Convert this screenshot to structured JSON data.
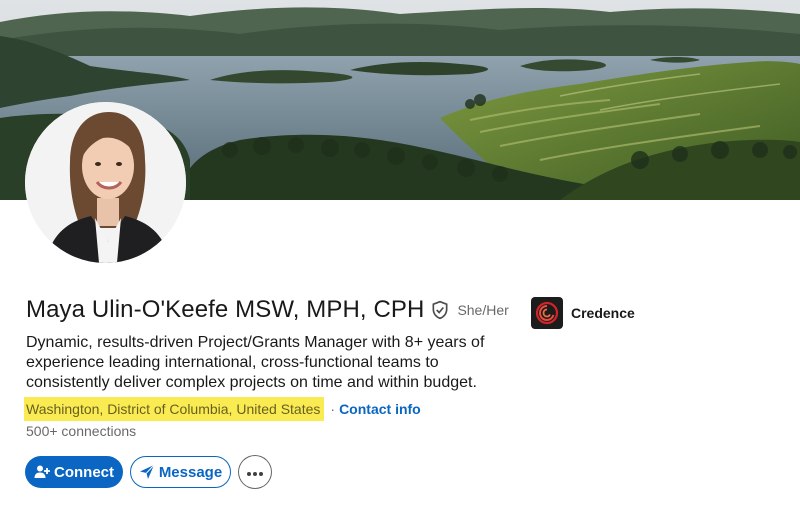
{
  "profile": {
    "name": "Maya Ulin-O'Keefe MSW, MPH, CPH",
    "pronouns": "She/Her",
    "headline": "Dynamic, results-driven Project/Grants Manager with 8+ years of experience leading international, cross-functional teams to consistently deliver complex projects on time and within budget.",
    "location": "Washington, District of Columbia, United States",
    "separator": "·",
    "contact_label": "Contact info",
    "connections": "500+ connections"
  },
  "company": {
    "name": "Credence",
    "logo_icon": "credence-swirl-logo"
  },
  "actions": {
    "connect_label": "Connect",
    "connect_icon": "add-person-icon",
    "message_label": "Message",
    "message_icon": "send-arrow-icon",
    "more_icon": "more-horizontal-icon"
  },
  "colors": {
    "brand_blue": "#0a66c2",
    "location_highlight": "#fbeb52"
  }
}
